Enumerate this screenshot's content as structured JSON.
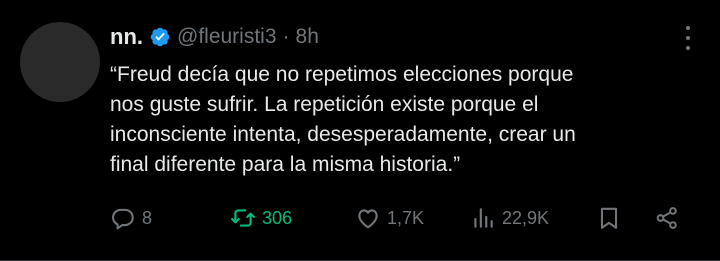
{
  "tweet": {
    "display_name": "nn.",
    "handle": "@fleuristi3",
    "separator": "·",
    "time": "8h",
    "text_lines": [
      "“Freud decía que no repetimos elecciones porque",
      "nos guste sufrir. La repetición existe porque el",
      "inconsciente intenta, desesperadamente, crear un",
      "final diferente para la misma historia.”"
    ]
  },
  "actions": {
    "replies": "8",
    "retweets": "306",
    "likes": "1,7K",
    "views": "22,9K"
  },
  "icons": {
    "verified": "verified-badge-icon",
    "more": "more-dots-icon",
    "reply": "reply-bubble-icon",
    "retweet": "retweet-icon",
    "like": "heart-icon",
    "views": "views-bar-chart-icon",
    "bookmark": "bookmark-icon",
    "share": "share-icon"
  },
  "colors": {
    "background": "#000000",
    "text": "#e7e9ea",
    "muted": "#71767b",
    "verified": "#1d9bf0",
    "retweet_active": "#00ba7c"
  }
}
